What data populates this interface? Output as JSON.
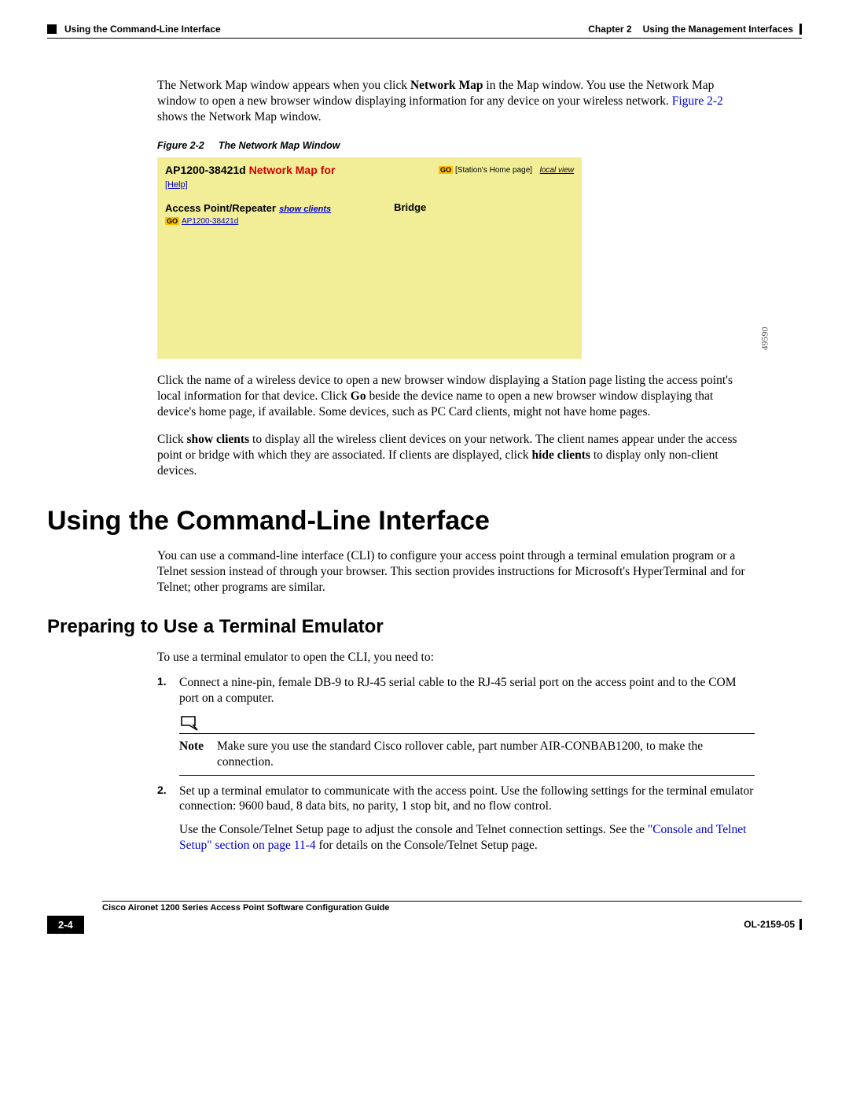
{
  "header": {
    "chapter_label": "Chapter 2",
    "chapter_title": "Using the Management Interfaces",
    "section_title": "Using the Command-Line Interface"
  },
  "intro": {
    "p1_a": "The Network Map window appears when you click ",
    "p1_b_bold": "Network Map",
    "p1_c": " in the Map window. You use the Network Map window to open a new browser window displaying information for any device on your wireless network. ",
    "p1_link": "Figure 2-2",
    "p1_d": " shows the Network Map window."
  },
  "figure": {
    "caption_num": "Figure 2-2",
    "caption_title": "The Network Map Window",
    "title_device": "AP1200-38421d",
    "title_label": " Network Map for",
    "help": "[Help]",
    "go": "GO",
    "stations_hp": "[Station's Home page]",
    "local_view": "local view",
    "apr": "Access Point/Repeater",
    "show_clients": "show clients",
    "bridge": "Bridge",
    "device_link": "AP1200-38421d",
    "side_id": "49590"
  },
  "after_fig": {
    "p2_a": "Click the name of a wireless device to open a new browser window displaying a Station page listing the access point's local information for that device. Click ",
    "p2_b_bold": "Go",
    "p2_c": " beside the device name to open a new browser window displaying that device's home page, if available. Some devices, such as PC Card clients, might not have home pages.",
    "p3_a": "Click ",
    "p3_b_bold": "show clients",
    "p3_c": " to display all the wireless client devices on your network. The client names appear under the access point or bridge with which they are associated. If clients are displayed, click ",
    "p3_d_bold": "hide clients",
    "p3_e": " to display only non-client devices."
  },
  "h1": "Using the Command-Line Interface",
  "cli_intro": "You can use a command-line interface (CLI) to configure your access point through a terminal emulation program or a Telnet session instead of through your browser. This section provides instructions for Microsoft's HyperTerminal and for Telnet; other programs are similar.",
  "h2": "Preparing to Use a Terminal Emulator",
  "prep_intro": "To use a terminal emulator to open the CLI, you need to:",
  "steps": {
    "s1_num": "1.",
    "s1_text": "Connect a nine-pin, female DB-9 to RJ-45 serial cable to the RJ-45 serial port on the access point and to the COM port on a computer.",
    "note_label": "Note",
    "note_text": "Make sure you use the standard Cisco rollover cable, part number AIR-CONBAB1200, to make the connection.",
    "s2_num": "2.",
    "s2_text": "Set up a terminal emulator to communicate with the access point. Use the following settings for the terminal emulator connection: 9600 baud, 8 data bits, no parity, 1 stop bit, and no flow control.",
    "s2_p2_a": "Use the Console/Telnet Setup page to adjust the console and Telnet connection settings. See the ",
    "s2_p2_link": "\"Console and Telnet Setup\" section on page 11-4",
    "s2_p2_b": " for details on the Console/Telnet Setup page."
  },
  "footer": {
    "book": "Cisco Aironet 1200 Series Access Point Software Configuration Guide",
    "page_num": "2-4",
    "doc_id": "OL-2159-05"
  }
}
